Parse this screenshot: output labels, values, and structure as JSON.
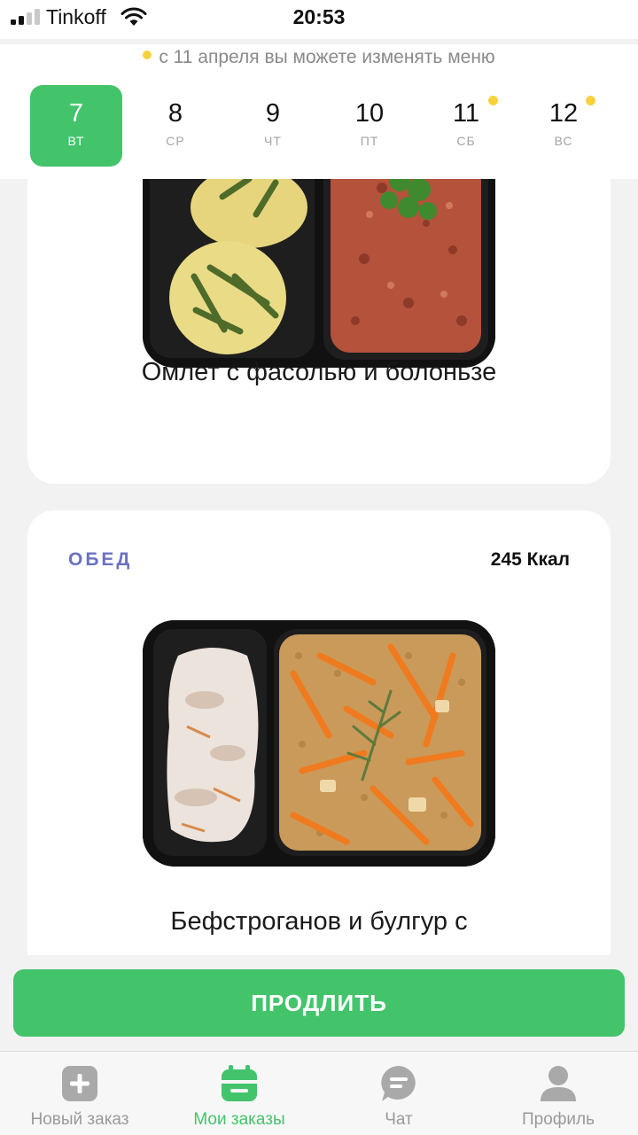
{
  "status_bar": {
    "carrier": "Tinkoff",
    "time": "20:53"
  },
  "notice": {
    "text": "с 11 апреля вы можете изменять меню"
  },
  "days": [
    {
      "num": "7",
      "weekday": "ВТ",
      "selected": true,
      "marked": false
    },
    {
      "num": "8",
      "weekday": "СР",
      "selected": false,
      "marked": false
    },
    {
      "num": "9",
      "weekday": "ЧТ",
      "selected": false,
      "marked": false
    },
    {
      "num": "10",
      "weekday": "ПТ",
      "selected": false,
      "marked": false
    },
    {
      "num": "11",
      "weekday": "СБ",
      "selected": false,
      "marked": true
    },
    {
      "num": "12",
      "weekday": "ВС",
      "selected": false,
      "marked": true
    }
  ],
  "meals": [
    {
      "dish": "Омлет с фасолью и болоньзе"
    },
    {
      "type": "ОБЕД",
      "kcal": "245 Ккал",
      "dish": "Бефстроганов и булгур с"
    }
  ],
  "extend_button": {
    "label": "ПРОДЛИТЬ"
  },
  "tabs": [
    {
      "label": "Новый заказ",
      "icon": "plus-square-icon"
    },
    {
      "label": "Мои заказы",
      "icon": "calendar-icon",
      "active": true
    },
    {
      "label": "Чат",
      "icon": "chat-bubble-icon"
    },
    {
      "label": "Профиль",
      "icon": "person-icon"
    }
  ],
  "colors": {
    "accent": "#43c46b",
    "meal_type": "#6b72c0",
    "marker": "#f7d23e"
  }
}
